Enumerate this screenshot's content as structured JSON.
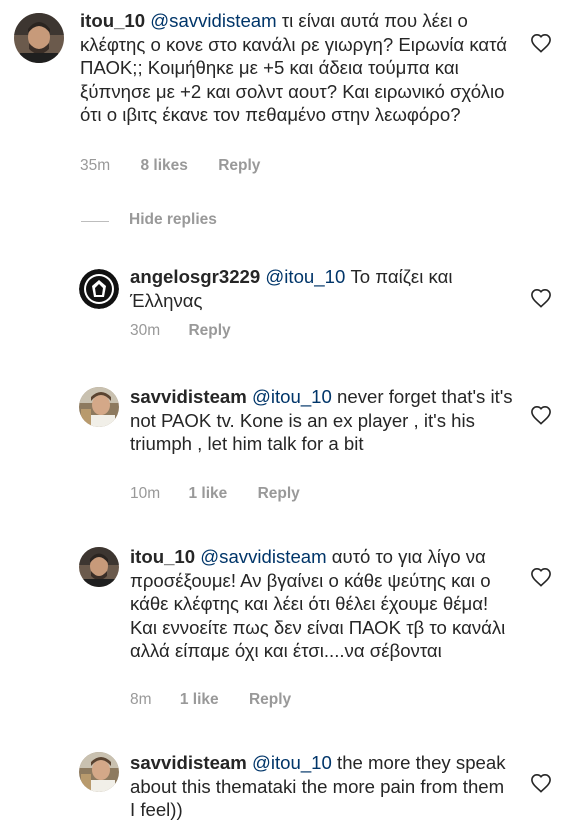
{
  "comments": [
    {
      "username": "itou_10",
      "mention": "@savvidisteam",
      "text": " τι είναι αυτά που λέει ο κλέφτης ο κονε στο κανάλι ρε γιωργη? Ειρωνία κατά ΠΑΟΚ;; Κοιμήθηκε με +5 και άδεια τούμπα και ξύπνησε με +2 και σολντ αουτ? Και ειρωνικό σχόλιο ότι ο ιβιτς έκανε τον πεθαμένο στην λεωφόρο?",
      "time": "35m",
      "likes": "8 likes",
      "reply": "Reply"
    },
    {
      "username": "angelosgr3229",
      "mention": "@itou_10",
      "text": " Το παίζει και Έλληνας",
      "time": "30m",
      "likes": "",
      "reply": "Reply"
    },
    {
      "username": "savvidisteam",
      "mention": "@itou_10",
      "text": " never forget that's it's not PAOK tv. Kone is an ex player ,  it's his triumph , let him talk for a bit",
      "time": "10m",
      "likes": "1 like",
      "reply": "Reply"
    },
    {
      "username": "itou_10",
      "mention": "@savvidisteam",
      "text": " αυτό το για λίγο να προσέξουμε! Αν βγαίνει ο κάθε ψεύτης και ο κάθε κλέφτης και λέει ότι θέλει έχουμε θέμα! Και εννοείτε πως δεν είναι ΠΑΟΚ τβ το κανάλι αλλά είπαμε όχι και έτσι....να σέβονται",
      "time": "8m",
      "likes": "1 like",
      "reply": "Reply"
    },
    {
      "username": "savvidisteam",
      "mention": "@itou_10",
      "text": " the more they speak about this themataki the more pain from them I feel))",
      "time": "",
      "likes": "",
      "reply": ""
    }
  ],
  "hide_replies": "Hide replies",
  "icons": {
    "like": "heart-outline-icon"
  },
  "colors": {
    "text": "#262626",
    "mention": "#003569",
    "meta": "#999999",
    "heart": "#262626"
  }
}
